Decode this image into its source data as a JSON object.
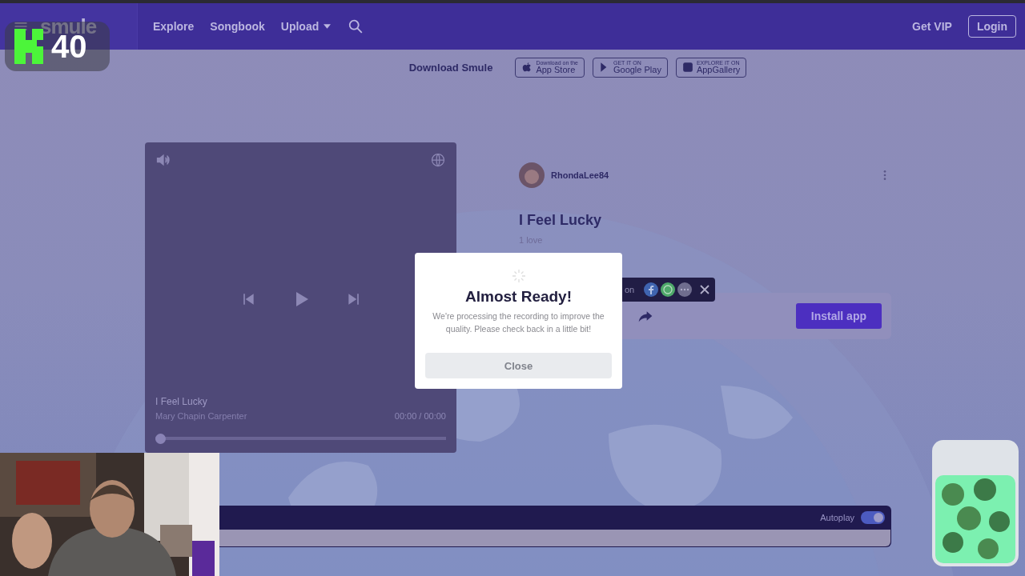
{
  "nav": {
    "logo": "smule",
    "links": [
      {
        "label": "Explore",
        "kind": "link"
      },
      {
        "label": "Songbook",
        "kind": "link"
      },
      {
        "label": "Upload",
        "kind": "dropdown"
      }
    ],
    "actions": [
      {
        "label": "Get VIP",
        "kind": "link"
      },
      {
        "label": "Login",
        "kind": "outlined"
      }
    ]
  },
  "download": {
    "label": "Download Smule",
    "stores": [
      {
        "kind": "apple",
        "small": "Download on the",
        "name": "App Store"
      },
      {
        "kind": "google",
        "small": "GET IT ON",
        "name": "Google Play"
      },
      {
        "kind": "gallery",
        "small": "EXPLORE IT ON",
        "name": "AppGallery"
      }
    ]
  },
  "player": {
    "title": "I Feel Lucky",
    "artist": "Mary Chapin Carpenter",
    "time": "00:00 / 00:00",
    "level": 0
  },
  "recording": {
    "user": "RhondaLee84",
    "title": "I Feel Lucky",
    "loves": "1 love"
  },
  "share": {
    "label": "on"
  },
  "install": {
    "label": "Install app"
  },
  "modal": {
    "title": "Almost Ready!",
    "message": "We're processing the recording to improve the quality. Please check back in a little bit!",
    "button": "Close"
  },
  "autoplay": {
    "label": "Autoplay",
    "on": true
  },
  "stream_overlay": {
    "counter": "40"
  }
}
